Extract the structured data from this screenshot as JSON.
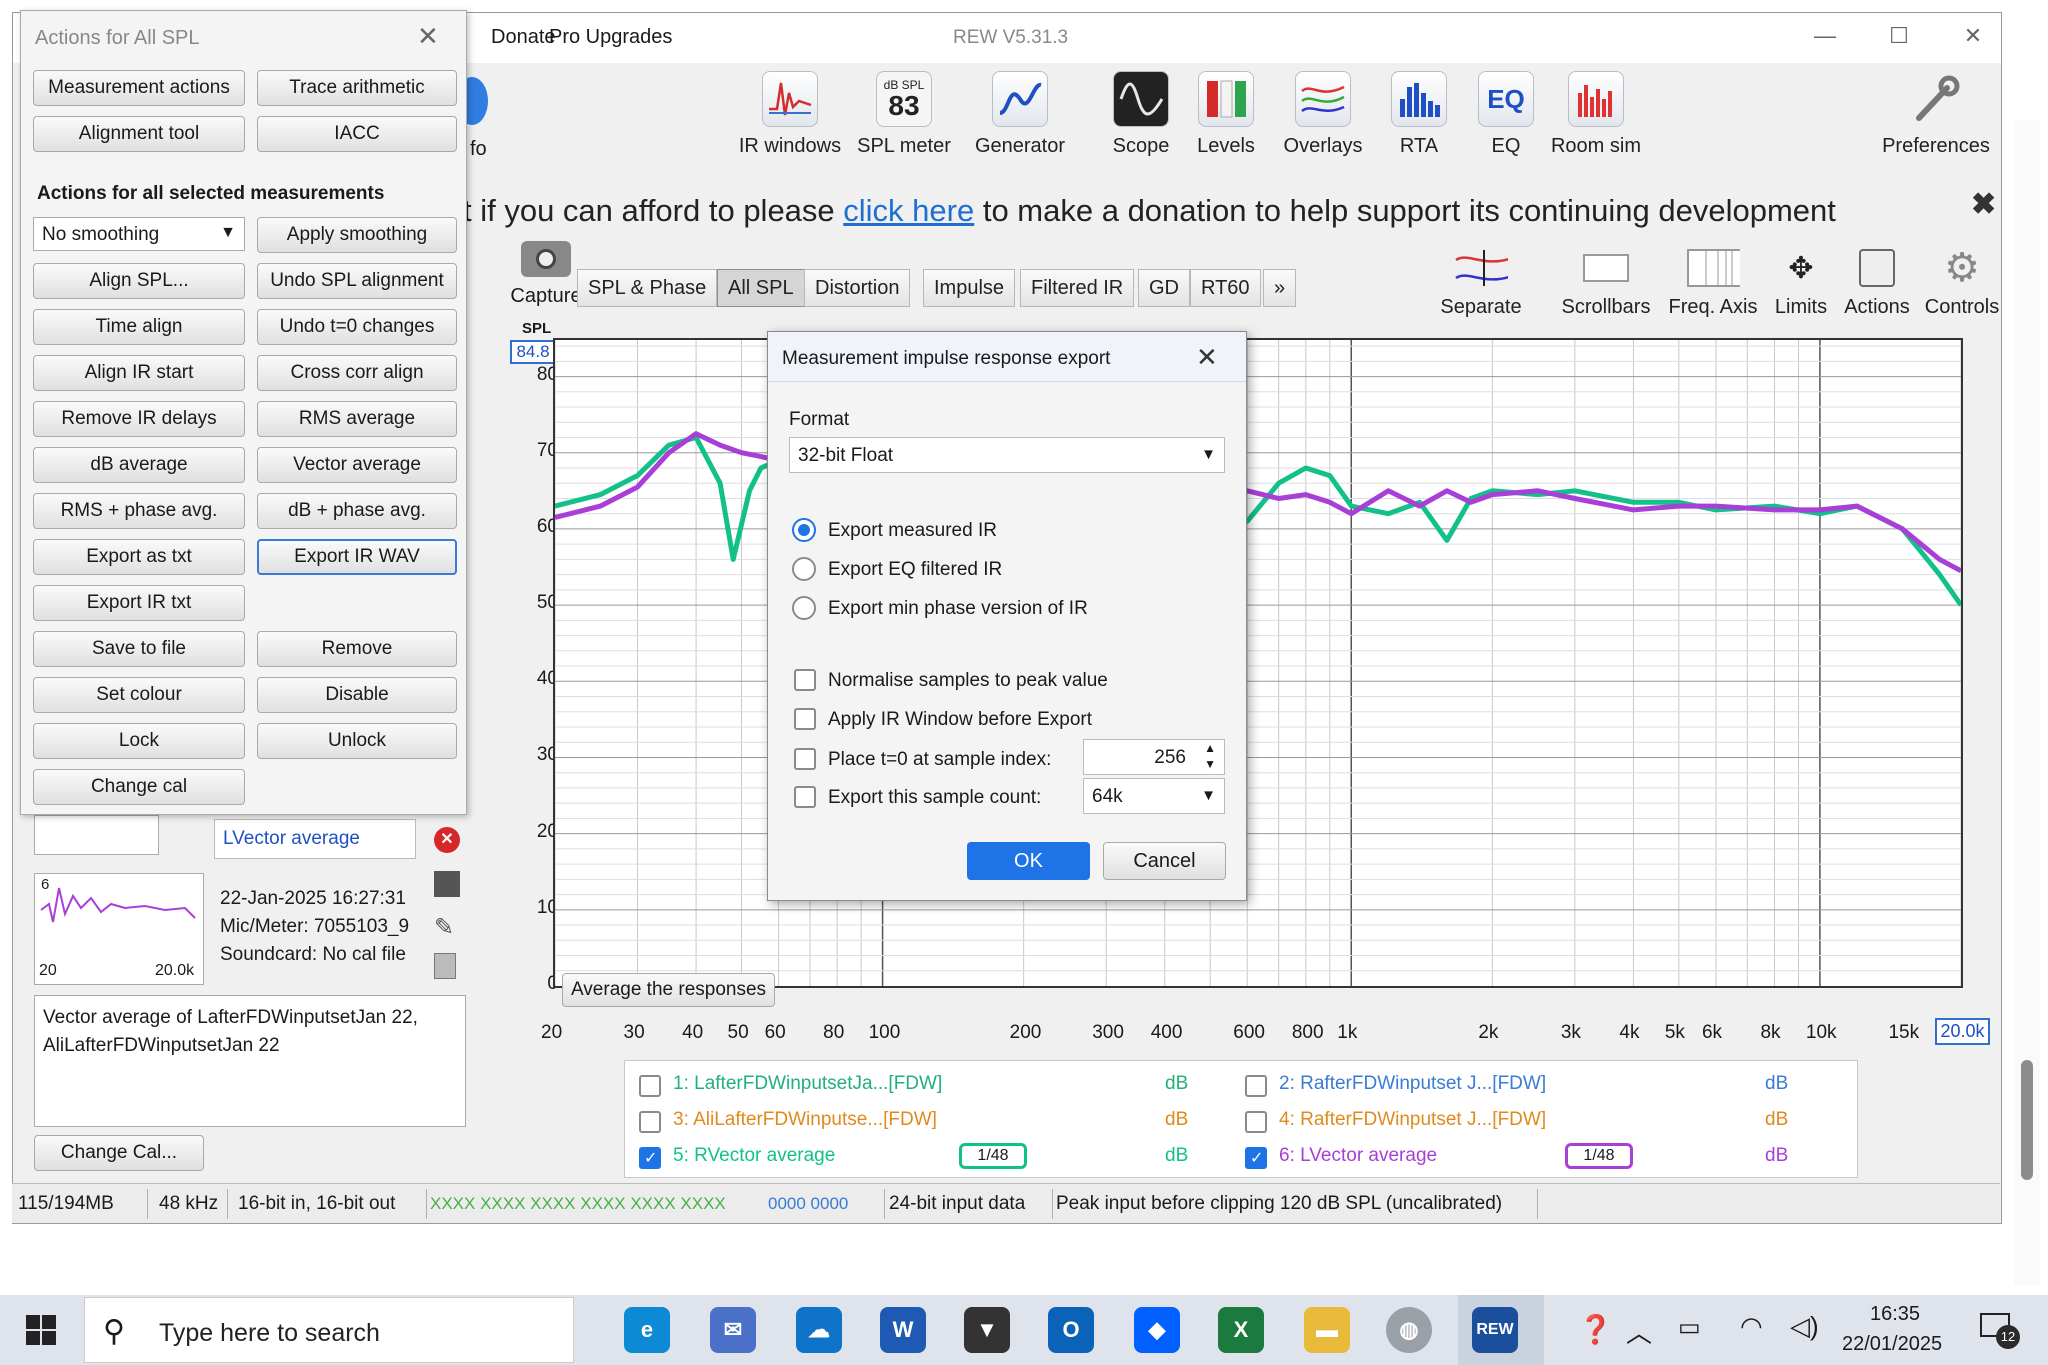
{
  "window": {
    "title": "REW V5.31.3",
    "menu": [
      "Donate",
      "Pro Upgrades"
    ]
  },
  "toolbar": [
    {
      "label": "IR windows",
      "icon": "ir-windows-icon"
    },
    {
      "label": "SPL meter",
      "icon": "spl-meter-icon",
      "meter_top": "dB SPL",
      "meter_value": "83"
    },
    {
      "label": "Generator",
      "icon": "generator-icon"
    },
    {
      "label": "Scope",
      "icon": "scope-icon"
    },
    {
      "label": "Levels",
      "icon": "levels-icon"
    },
    {
      "label": "Overlays",
      "icon": "overlays-icon"
    },
    {
      "label": "RTA",
      "icon": "rta-icon"
    },
    {
      "label": "EQ",
      "icon": "eq-icon",
      "icon_text": "EQ"
    },
    {
      "label": "Room sim",
      "icon": "room-sim-icon"
    },
    {
      "label": "Preferences",
      "icon": "preferences-icon"
    }
  ],
  "partial_toolbar_label": "fo",
  "donation": {
    "before": "t if you can afford to please ",
    "link": "click here",
    "after": " to make a donation to help support its continuing development"
  },
  "capture_label": "Capture",
  "tabs": [
    "SPL & Phase",
    "All SPL",
    "Distortion",
    "Impulse",
    "Filtered IR",
    "GD",
    "RT60",
    "»"
  ],
  "graph_tools": [
    "Separate",
    "Scrollbars",
    "Freq. Axis",
    "Limits",
    "Actions",
    "Controls"
  ],
  "graph": {
    "y_axis_title": "SPL",
    "y_top_value": "84.8",
    "x_right_value": "20.0k",
    "average_button": "Average the responses"
  },
  "actions_panel": {
    "title": "Actions for All SPL",
    "top_buttons": [
      "Measurement actions",
      "Trace arithmetic",
      "Alignment tool",
      "IACC"
    ],
    "section_title": "Actions for all selected measurements",
    "smoothing_value": "No smoothing",
    "buttons": [
      "Apply smoothing",
      "Align SPL...",
      "Undo SPL alignment",
      "Time align",
      "Undo t=0 changes",
      "Align IR start",
      "Cross corr align",
      "Remove IR delays",
      "RMS average",
      "dB average",
      "Vector average",
      "RMS + phase avg.",
      "dB + phase avg.",
      "Export as txt",
      "Export IR WAV",
      "Export IR txt",
      "Save to file",
      "Remove",
      "Set colour",
      "Disable",
      "Lock",
      "Unlock",
      "Change cal"
    ]
  },
  "measurement_panel": {
    "name": "LVector average",
    "date": "22-Jan-2025 16:27:31",
    "mic": "Mic/Meter: 7055103_9",
    "soundcard": "Soundcard: No cal file",
    "thumb_min": "20",
    "thumb_max": "20.0k",
    "thumb_top": "6",
    "notes": "Vector average of LafterFDWinputsetJan 22, AliLafterFDWinputsetJan 22",
    "change_cal": "Change Cal..."
  },
  "dialog": {
    "title": "Measurement impulse response export",
    "format_label": "Format",
    "format_value": "32-bit Float",
    "radios": [
      "Export measured IR",
      "Export EQ filtered IR",
      "Export min phase version of IR"
    ],
    "radio_selected": 0,
    "checks": [
      "Normalise samples to peak value",
      "Apply IR Window before Export",
      "Place t=0 at sample index:",
      "Export this sample count:"
    ],
    "sample_index": "256",
    "sample_count": "64k",
    "ok": "OK",
    "cancel": "Cancel"
  },
  "legend": [
    {
      "label": "1: LafterFDWinputsetJa...[FDW]",
      "unit": "dB",
      "checked": false,
      "color": "#22b07a"
    },
    {
      "label": "2: RafterFDWinputset J...[FDW]",
      "unit": "dB",
      "checked": false,
      "color": "#3a7bd5"
    },
    {
      "label": "3: AliLafterFDWinputse...[FDW]",
      "unit": "dB",
      "checked": false,
      "color": "#e08a1e"
    },
    {
      "label": "4: RafterFDWinputset J...[FDW]",
      "unit": "dB",
      "checked": false,
      "color": "#e08a1e"
    },
    {
      "label": "5: RVector average",
      "unit": "dB",
      "checked": true,
      "color": "#12c08a",
      "smoothing": "1/48"
    },
    {
      "label": "6: LVector average",
      "unit": "dB",
      "checked": true,
      "color": "#a83fd6",
      "smoothing": "1/48"
    }
  ],
  "status": [
    "115/194MB",
    "48 kHz",
    "16-bit in, 16-bit out",
    "XXXX XXXX  XXXX XXXX  XXXX XXXX",
    "0000 0000",
    "24-bit input data",
    "Peak input before clipping 120 dB SPL (uncalibrated)"
  ],
  "taskbar": {
    "search_placeholder": "Type here to search",
    "time": "16:35",
    "date": "22/01/2025",
    "notifications": "12"
  },
  "chart_data": {
    "type": "line",
    "ylabel": "SPL",
    "ylim": [
      0,
      84.8
    ],
    "xlim": [
      20,
      20000
    ],
    "x_scale": "log",
    "y_ticks": [
      "80",
      "70",
      "60",
      "50",
      "40",
      "30",
      "20",
      "10",
      "0"
    ],
    "x_ticks": [
      {
        "v": 20,
        "t": "20"
      },
      {
        "v": 30,
        "t": "30"
      },
      {
        "v": 40,
        "t": "40"
      },
      {
        "v": 50,
        "t": "50"
      },
      {
        "v": 60,
        "t": "60"
      },
      {
        "v": 80,
        "t": "80"
      },
      {
        "v": 100,
        "t": "100"
      },
      {
        "v": 200,
        "t": "200"
      },
      {
        "v": 300,
        "t": "300"
      },
      {
        "v": 400,
        "t": "400"
      },
      {
        "v": 600,
        "t": "600"
      },
      {
        "v": 800,
        "t": "800"
      },
      {
        "v": 1000,
        "t": "1k"
      },
      {
        "v": 2000,
        "t": "2k"
      },
      {
        "v": 3000,
        "t": "3k"
      },
      {
        "v": 4000,
        "t": "4k"
      },
      {
        "v": 5000,
        "t": "5k"
      },
      {
        "v": 6000,
        "t": "6k"
      },
      {
        "v": 8000,
        "t": "8k"
      },
      {
        "v": 10000,
        "t": "10k"
      },
      {
        "v": 15000,
        "t": "15k"
      }
    ],
    "series": [
      {
        "name": "5: RVector average",
        "color": "#12c08a",
        "x": [
          20,
          25,
          30,
          35,
          40,
          45,
          48,
          52,
          55,
          60,
          600,
          700,
          800,
          900,
          1000,
          1200,
          1400,
          1600,
          1800,
          2000,
          2500,
          3000,
          4000,
          5000,
          6000,
          8000,
          10000,
          12000,
          15000,
          18000,
          20000
        ],
        "y": [
          63,
          64.5,
          67,
          71,
          72,
          66,
          56,
          65,
          68,
          69,
          61,
          66,
          68,
          67,
          63,
          62,
          63.5,
          58.5,
          64,
          65,
          64.5,
          65,
          63.5,
          63.5,
          62.5,
          63,
          62,
          63,
          60,
          54,
          50
        ]
      },
      {
        "name": "6: LVector average",
        "color": "#a83fd6",
        "x": [
          20,
          25,
          30,
          35,
          40,
          45,
          50,
          55,
          60,
          600,
          700,
          800,
          900,
          1000,
          1200,
          1400,
          1600,
          1800,
          2000,
          2500,
          3000,
          4000,
          5000,
          6000,
          8000,
          10000,
          12000,
          15000,
          18000,
          20000
        ],
        "y": [
          61.5,
          63,
          65.5,
          70,
          72.5,
          71,
          70,
          69.5,
          69,
          65,
          64,
          64.5,
          63.5,
          62,
          65,
          63,
          65,
          63.5,
          64.5,
          65,
          64,
          62.5,
          63,
          63,
          62.5,
          62.5,
          63,
          60,
          56,
          54.5
        ]
      }
    ]
  }
}
